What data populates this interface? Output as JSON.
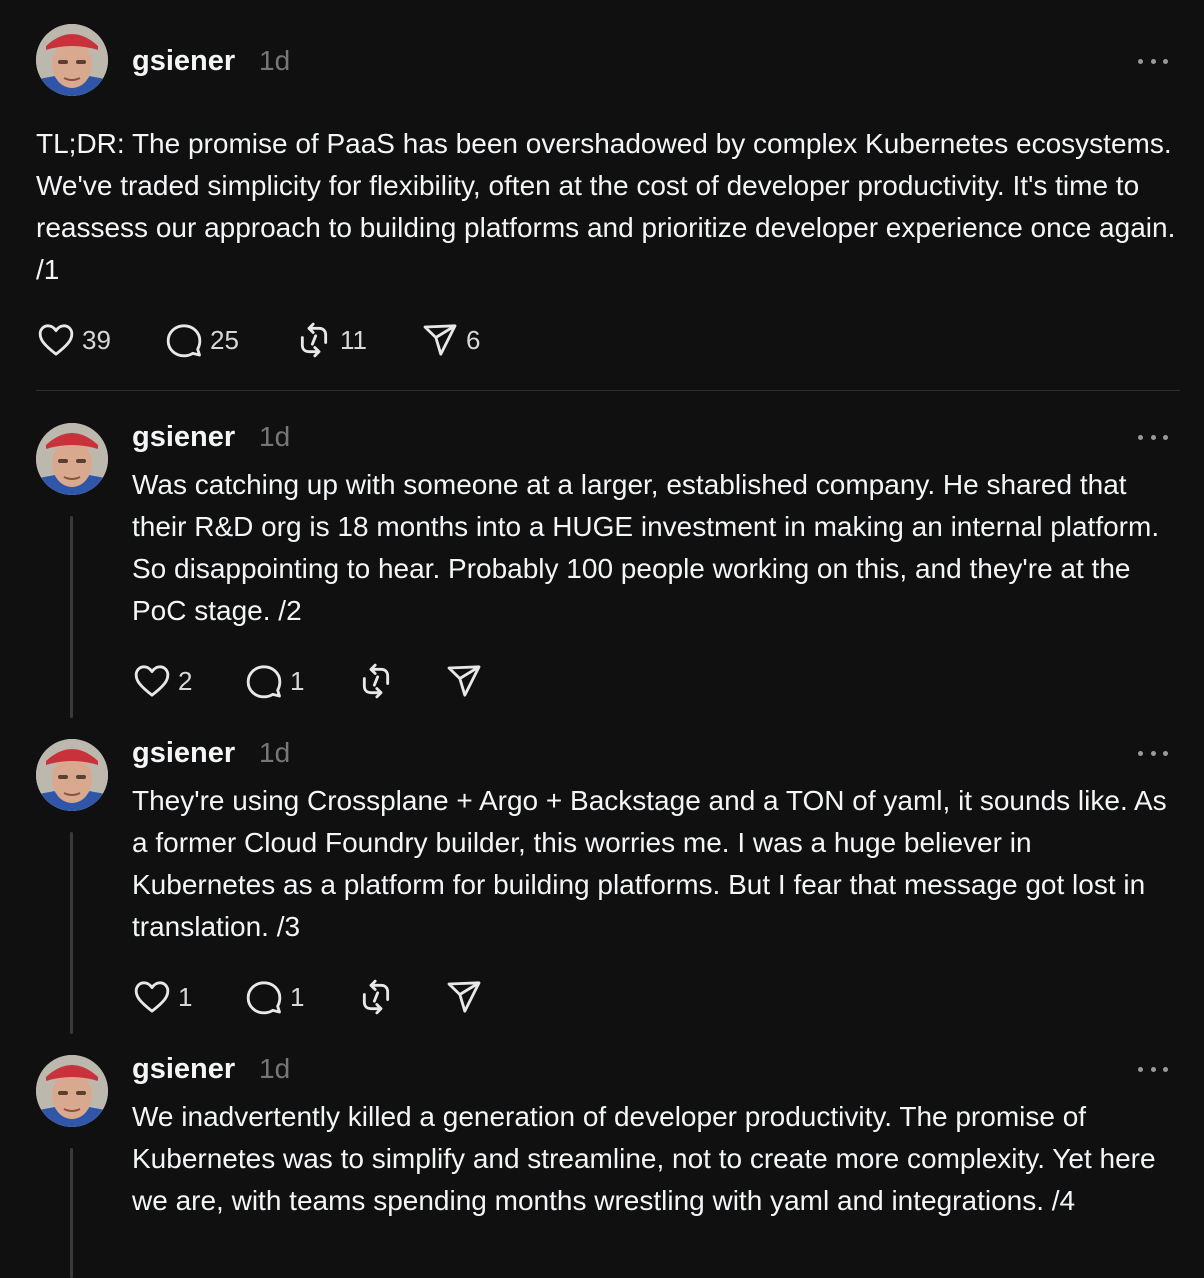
{
  "posts": [
    {
      "username": "gsiener",
      "time": "1d",
      "text": "TL;DR: The promise of PaaS has been overshadowed by complex Kubernetes ecosystems. We've traded simplicity for flexibility, often at the cost of developer productivity. It's time to reassess our approach to building platforms and prioritize developer experience once again. /1",
      "likes": "39",
      "replies": "25",
      "reposts": "11",
      "shares": "6"
    },
    {
      "username": "gsiener",
      "time": "1d",
      "text": "Was catching up with someone at a larger, established company. He shared that their R&D org is 18 months into a HUGE investment in making an internal platform. So disappointing to hear. Probably 100 people working on this, and they're at the PoC stage. /2",
      "likes": "2",
      "replies": "1"
    },
    {
      "username": "gsiener",
      "time": "1d",
      "text": "They're using Crossplane + Argo + Backstage and a TON of yaml, it sounds like. As a former Cloud Foundry builder, this worries me. I was a huge believer in Kubernetes as a platform for building platforms. But I fear that message got lost in translation. /3",
      "likes": "1",
      "replies": "1"
    },
    {
      "username": "gsiener",
      "time": "1d",
      "text": "We inadvertently killed a generation of developer productivity. The promise of Kubernetes was to simplify and streamline, not to create more complexity. Yet here we are, with teams spending months wrestling with yaml and integrations. /4"
    }
  ],
  "icons": {
    "like": "heart-icon",
    "reply": "comment-icon",
    "repost": "repost-icon",
    "share": "send-icon",
    "more": "more-icon"
  },
  "colors": {
    "background": "#101010",
    "text": "#f3f5f7",
    "muted": "#777777"
  }
}
